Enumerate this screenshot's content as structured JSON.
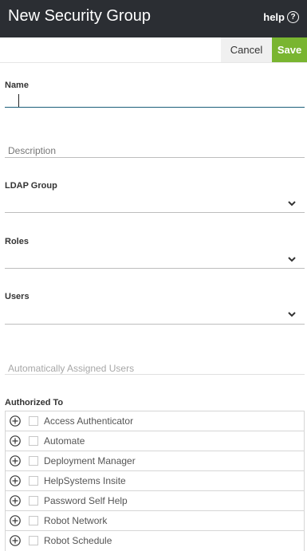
{
  "header": {
    "title": "New Security Group",
    "help_label": "help",
    "help_icon": "?"
  },
  "actions": {
    "cancel_label": "Cancel",
    "save_label": "Save"
  },
  "form": {
    "name_label": "Name",
    "name_value": "",
    "description_placeholder": "Description",
    "ldap_group_label": "LDAP Group",
    "roles_label": "Roles",
    "users_label": "Users",
    "auto_users_placeholder": "Automatically Assigned Users",
    "authorized_to_label": "Authorized To"
  },
  "authorized_items": [
    {
      "label": "Access Authenticator"
    },
    {
      "label": "Automate"
    },
    {
      "label": "Deployment Manager"
    },
    {
      "label": "HelpSystems Insite"
    },
    {
      "label": "Password Self Help"
    },
    {
      "label": "Robot Network"
    },
    {
      "label": "Robot Schedule"
    }
  ],
  "colors": {
    "header_bg": "#2b2e33",
    "save_bg": "#79b530",
    "active_underline": "#1b5e7a"
  }
}
